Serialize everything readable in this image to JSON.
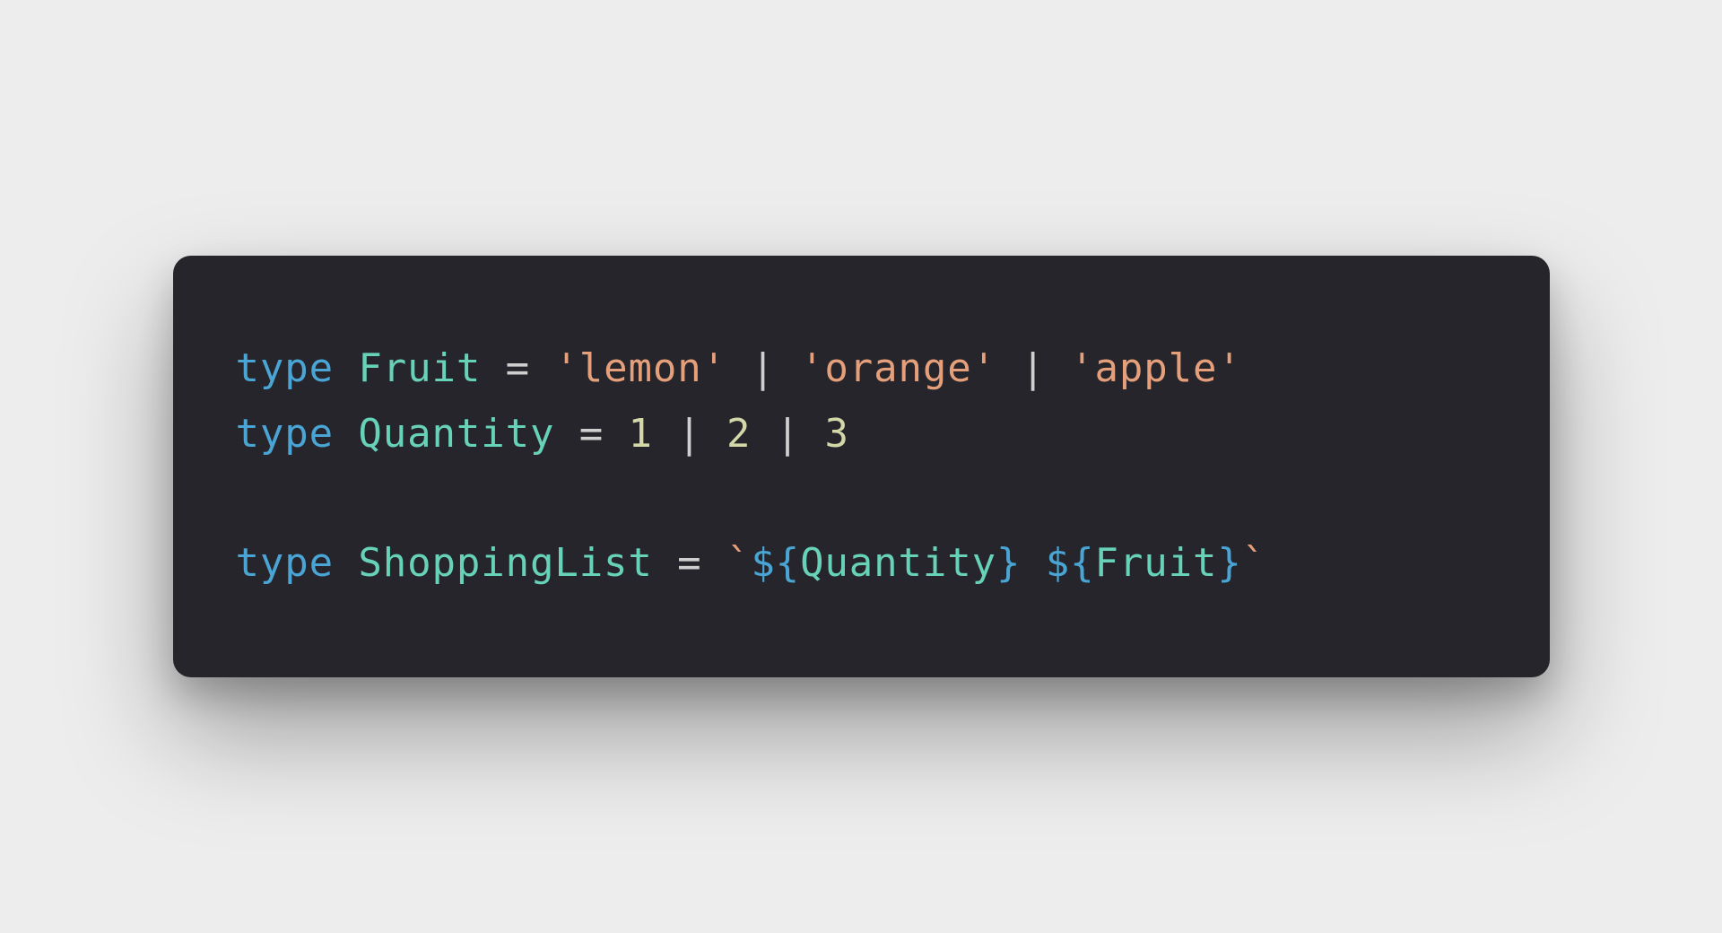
{
  "code": {
    "line1": {
      "kw": "type",
      "name": "Fruit",
      "eq": " = ",
      "s1": "'lemon'",
      "pipe1": " | ",
      "s2": "'orange'",
      "pipe2": " | ",
      "s3": "'apple'"
    },
    "line2": {
      "kw": "type",
      "name": "Quantity",
      "eq": " = ",
      "n1": "1",
      "pipe1": " | ",
      "n2": "2",
      "pipe2": " | ",
      "n3": "3"
    },
    "line3": {
      "kw": "type",
      "name": "ShoppingList",
      "eq": " = ",
      "bt1": "`",
      "dl1a": "${",
      "ref1": "Quantity",
      "dl1b": "}",
      "space": " ",
      "dl2a": "${",
      "ref2": "Fruit",
      "dl2b": "}",
      "bt2": "`"
    }
  },
  "colors": {
    "background": "#ededed",
    "panel": "#25252b",
    "keyword": "#4aa5d4",
    "type": "#67d2b8",
    "operator": "#cfcfcf",
    "string": "#e5a07b",
    "number": "#d4d8a9"
  }
}
